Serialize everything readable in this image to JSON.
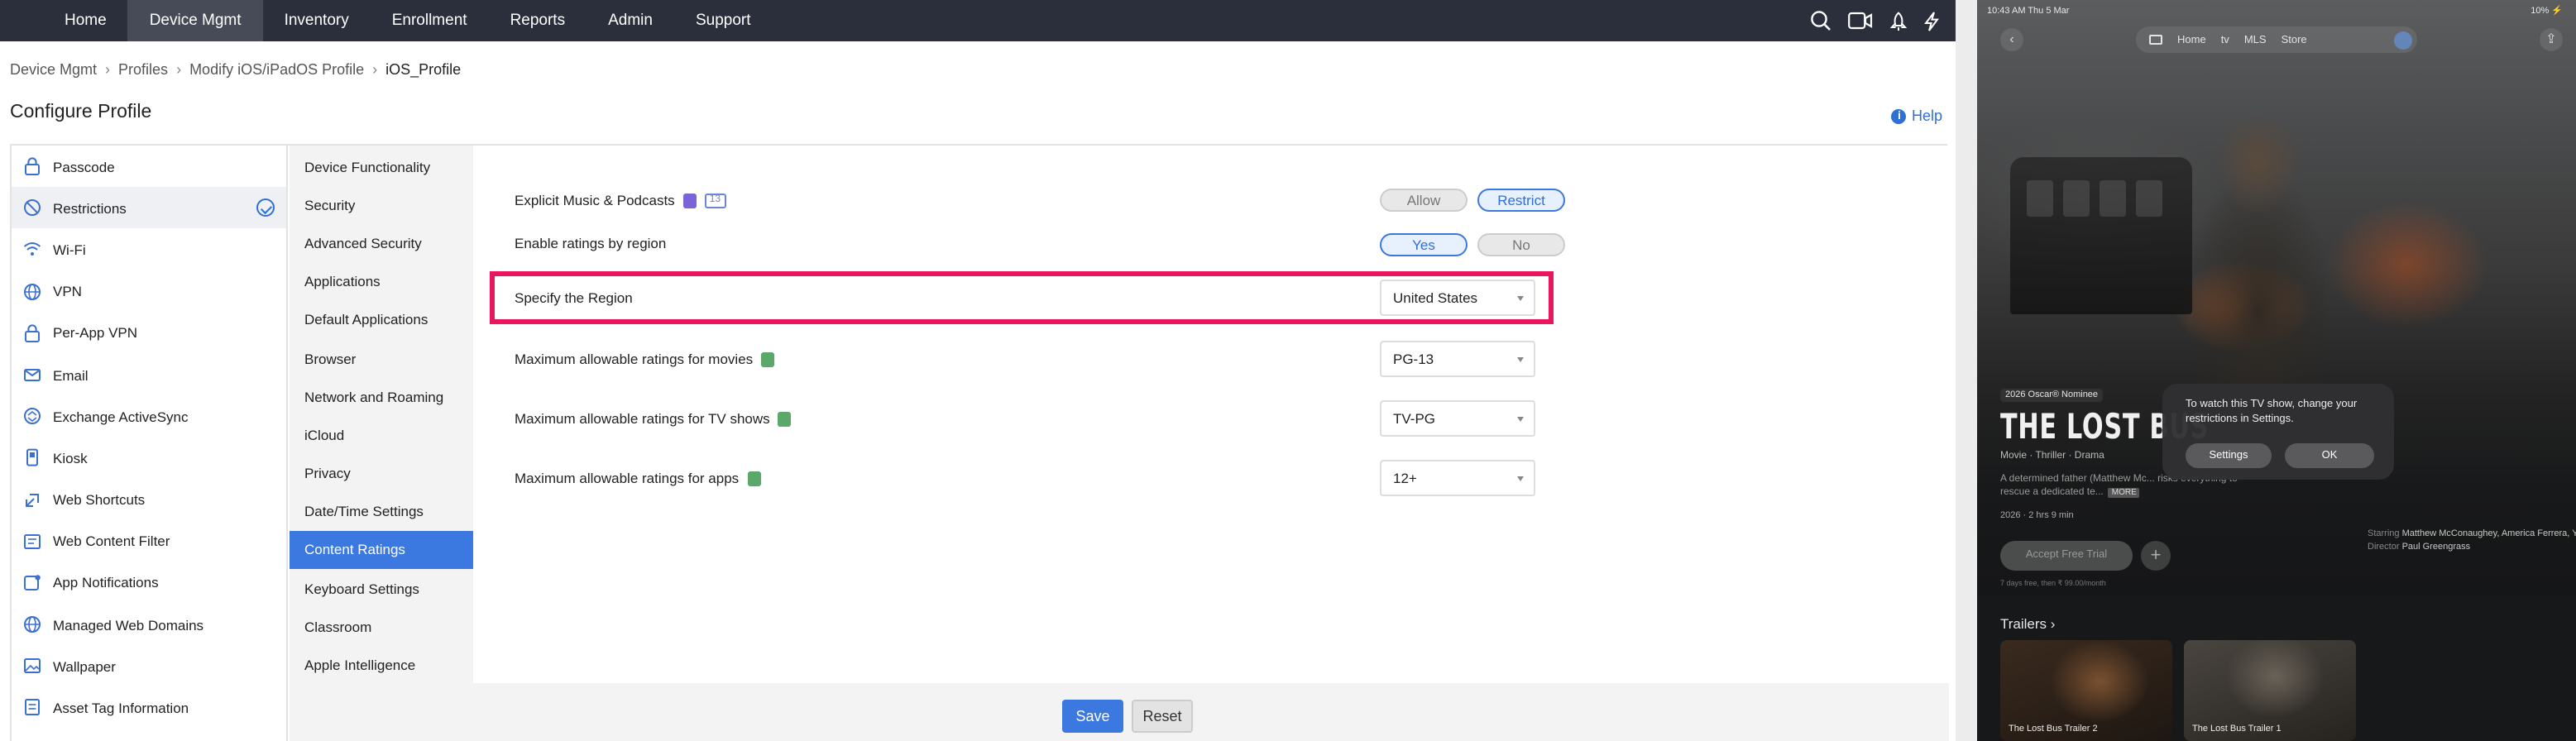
{
  "mdm": {
    "nav": [
      "Home",
      "Device Mgmt",
      "Inventory",
      "Enrollment",
      "Reports",
      "Admin",
      "Support"
    ],
    "nav_active": "Device Mgmt",
    "topbar_icons": [
      "search-icon",
      "video-icon",
      "rocket-icon",
      "lightning-icon"
    ],
    "breadcrumb": [
      "Device Mgmt",
      "Profiles",
      "Modify iOS/iPadOS Profile",
      "iOS_Profile"
    ],
    "page_title": "Configure Profile",
    "help_label": "Help",
    "profile_sections": [
      {
        "label": "Passcode",
        "icon": "lock-icon"
      },
      {
        "label": "Restrictions",
        "icon": "restriction-icon",
        "active": true,
        "configured": true
      },
      {
        "label": "Wi-Fi",
        "icon": "wifi-icon"
      },
      {
        "label": "VPN",
        "icon": "globe-icon"
      },
      {
        "label": "Per-App VPN",
        "icon": "lock-icon"
      },
      {
        "label": "Email",
        "icon": "mail-icon"
      },
      {
        "label": "Exchange ActiveSync",
        "icon": "sync-icon"
      },
      {
        "label": "Kiosk",
        "icon": "kiosk-icon"
      },
      {
        "label": "Web Shortcuts",
        "icon": "shortcut-icon"
      },
      {
        "label": "Web Content Filter",
        "icon": "filter-icon"
      },
      {
        "label": "App Notifications",
        "icon": "notification-icon"
      },
      {
        "label": "Managed Web Domains",
        "icon": "globe-icon"
      },
      {
        "label": "Wallpaper",
        "icon": "image-icon"
      },
      {
        "label": "Asset Tag Information",
        "icon": "tag-icon"
      }
    ],
    "restriction_categories": [
      "Device Functionality",
      "Security",
      "Advanced Security",
      "Applications",
      "Default Applications",
      "Browser",
      "Network and Roaming",
      "iCloud",
      "Privacy",
      "Date/Time Settings",
      "Content Ratings",
      "Keyboard Settings",
      "Classroom",
      "Apple Intelligence"
    ],
    "active_category": "Content Ratings",
    "settings": {
      "explicit": {
        "label": "Explicit Music & Podcasts",
        "badge": "13",
        "options": [
          "Allow",
          "Restrict"
        ],
        "selected": "Restrict"
      },
      "ratings_by_region": {
        "label": "Enable ratings by region",
        "options": [
          "Yes",
          "No"
        ],
        "selected": "Yes"
      },
      "region": {
        "label": "Specify the Region",
        "value": "United States"
      },
      "movies": {
        "label": "Maximum allowable ratings for movies",
        "value": "PG-13"
      },
      "tv": {
        "label": "Maximum allowable ratings for TV shows",
        "value": "TV-PG"
      },
      "apps": {
        "label": "Maximum allowable ratings for apps",
        "value": "12+"
      }
    },
    "buttons": {
      "save": "Save",
      "reset": "Reset"
    },
    "colors": {
      "topbar": "#2b2f3b",
      "accent": "#3b78e0",
      "highlight": "#e8175f"
    }
  },
  "ipad": {
    "status_left": "10:43 AM  Thu 5 Mar",
    "status_right": "10% ⚡",
    "tabs": [
      "Home",
      "tv",
      "MLS",
      "Store"
    ],
    "badge": "2026 Oscar® Nominee",
    "title": "THE LOST BUS",
    "meta": "Movie · Thriller · Drama",
    "description": "A determined father (Matthew Mc... risks everything to rescue a dedicated te...",
    "more_label": "MORE",
    "runtime": "2026 · 2 hrs 9 min",
    "trial_button": "Accept Free Trial",
    "trial_note": "7 days free, then ₹ 99.00/month",
    "starring_label": "Starring",
    "starring": "Matthew McConaughey, America Ferrera, Yul Vazquez",
    "director_label": "Director",
    "director": "Paul Greengrass",
    "trailers_heading": "Trailers",
    "trailers": [
      "The Lost Bus Trailer 2",
      "The Lost Bus Trailer 1"
    ],
    "alert": {
      "message": "To watch this TV show, change your restrictions in Settings.",
      "buttons": [
        "Settings",
        "OK"
      ]
    }
  }
}
